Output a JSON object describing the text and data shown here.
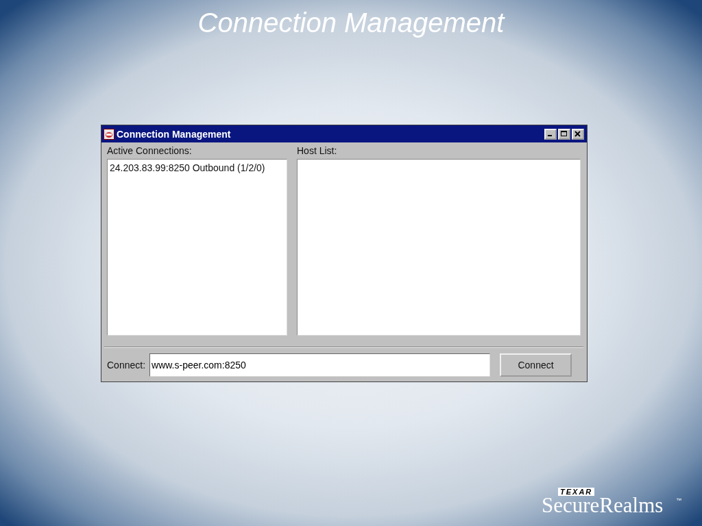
{
  "slide": {
    "title": "Connection Management"
  },
  "window": {
    "title": "Connection Management"
  },
  "active_connections": {
    "label": "Active Connections:",
    "items": [
      {
        "text": "24.203.83.99:8250 Outbound (1/2/0)",
        "selected": false
      }
    ]
  },
  "host_list": {
    "label": "Host List:"
  },
  "connect": {
    "label": "Connect:",
    "value": "www.s-peer.com:8250",
    "button": "Connect"
  },
  "logo": {
    "tag": "TEXAR",
    "name": "SecureRealms",
    "mark": "™"
  }
}
